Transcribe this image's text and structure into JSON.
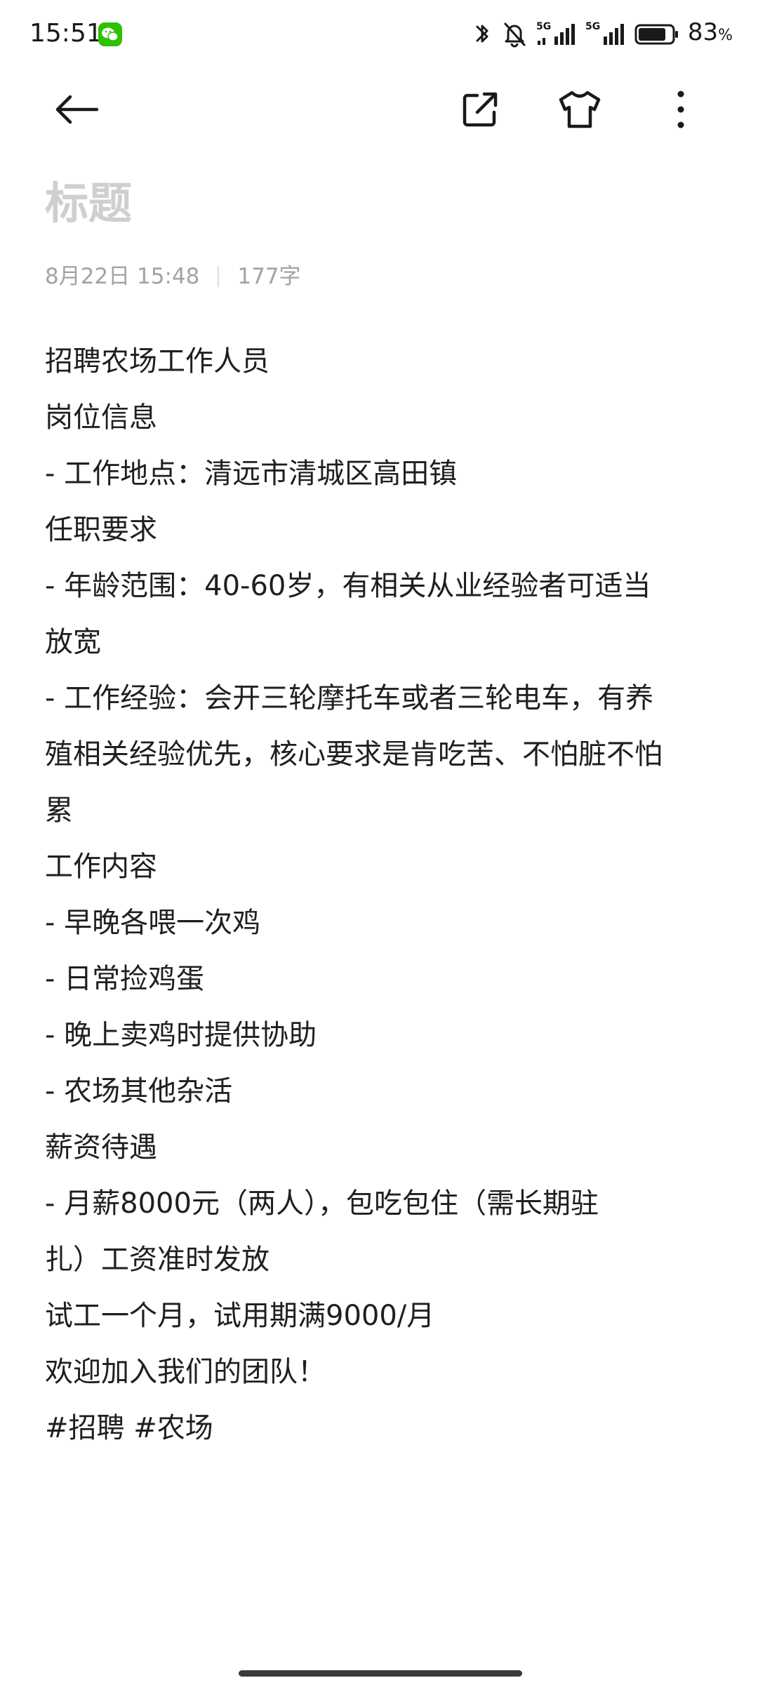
{
  "status_bar": {
    "time": "15:51",
    "app_icon": "wechat-icon",
    "network_1": "5G",
    "network_2": "5G",
    "battery_value": "83",
    "battery_unit": "%",
    "battery_level": 0.83
  },
  "toolbar": {
    "back_icon": "arrow-left-icon",
    "share_icon": "share-icon",
    "theme_icon": "tshirt-icon",
    "more_icon": "more-vertical-icon"
  },
  "note": {
    "title_placeholder": "标题",
    "date": "8月22日 15:48",
    "word_count": "177字",
    "lines": [
      "招聘农场工作人员",
      "岗位信息",
      "- 工作地点：清远市清城区高田镇",
      "任职要求",
      "- 年龄范围：40-60岁，有相关从业经验者可适当",
      "放宽",
      "- 工作经验：会开三轮摩托车或者三轮电车，有养",
      "殖相关经验优先，核心要求是肯吃苦、不怕脏不怕",
      "累",
      "工作内容",
      "- 早晚各喂一次鸡",
      "- 日常捡鸡蛋",
      "- 晚上卖鸡时提供协助",
      "- 农场其他杂活",
      "薪资待遇",
      "- 月薪8000元（两人），包吃包住（需长期驻",
      "扎）工资准时发放",
      "试工一个月，试用期满9000/月",
      "欢迎加入我们的团队！",
      "#招聘 #农场"
    ]
  },
  "colors": {
    "background": "#ffffff",
    "text": "#1f1f1f",
    "title_placeholder": "#cfcfcf",
    "meta": "#a3a3a3",
    "wechat_green": "#2dc100"
  }
}
